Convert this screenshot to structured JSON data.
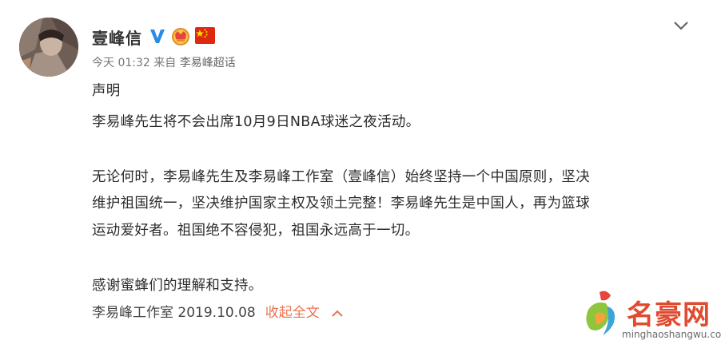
{
  "post": {
    "author": "壹峰信",
    "time": "今天 01:32",
    "source_prefix": "来自",
    "source": "李易峰超话",
    "lines": [
      "声明",
      "李易峰先生将不会出席10月9日NBA球迷之夜活动。",
      "无论何时，李易峰先生及李易峰工作室（壹峰信）始终坚持一个中国原则，坚决",
      "维护祖国统一，坚决维护国家主权及领土完整！李易峰先生是中国人，再为篮球",
      "运动爱好者。祖国绝不容侵犯，祖国永远高于一切。",
      "感谢蜜蜂们的理解和支持。"
    ],
    "signature": "李易峰工作室 2019.10.08",
    "collapse_label": "收起全文"
  },
  "icons": {
    "verified": "verified-v-icon",
    "crown": "crown-badge-icon",
    "flag": "china-flag-icon",
    "menu": "chevron-down-icon",
    "collapse": "chevron-up-icon"
  },
  "watermark": {
    "text": "名豪网",
    "url": "minghaoshangwu.com"
  },
  "colors": {
    "accent": "#eb7350",
    "verified": "#2a8be2",
    "flag": "#de2910",
    "watermark": "#e04a2e"
  }
}
